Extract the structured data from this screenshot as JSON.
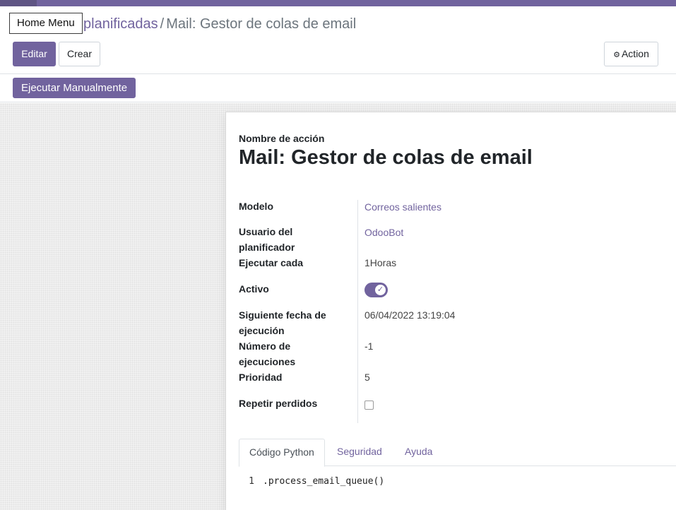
{
  "breadcrumb": {
    "parent_partial": "planificadas",
    "separator": "/",
    "current": "Mail: Gestor de colas de email"
  },
  "home_menu_label": "Home Menu",
  "toolbar": {
    "edit_label": "Editar",
    "create_label": "Crear",
    "action_label": "Action"
  },
  "statusbar": {
    "run_label": "Ejecutar Manualmente"
  },
  "form": {
    "name_label": "Nombre de acción",
    "name_value": "Mail: Gestor de colas de email",
    "fields": {
      "model": {
        "label": "Modelo",
        "value": "Correos salientes"
      },
      "user": {
        "label": "Usuario del planificador",
        "value": "OdooBot"
      },
      "interval": {
        "label": "Ejecutar cada",
        "value": "1Horas"
      },
      "active": {
        "label": "Activo",
        "value": true
      },
      "nextcall": {
        "label": "Siguiente fecha de ejecución",
        "value": "06/04/2022 13:19:04"
      },
      "numbercall": {
        "label": "Número de ejecuciones",
        "value": "-1"
      },
      "priority": {
        "label": "Prioridad",
        "value": "5"
      },
      "doall": {
        "label": "Repetir perdidos",
        "value": false
      }
    },
    "tabs": [
      {
        "label": "Código Python",
        "active": true
      },
      {
        "label": "Seguridad",
        "active": false
      },
      {
        "label": "Ayuda",
        "active": false
      }
    ],
    "code": {
      "line_number": "1",
      "line": ".process_email_queue()"
    }
  },
  "colors": {
    "brand": "#71639e",
    "topbar": "#71639e"
  },
  "icons": {
    "action": "gear-icon",
    "toggle": "check-icon"
  }
}
